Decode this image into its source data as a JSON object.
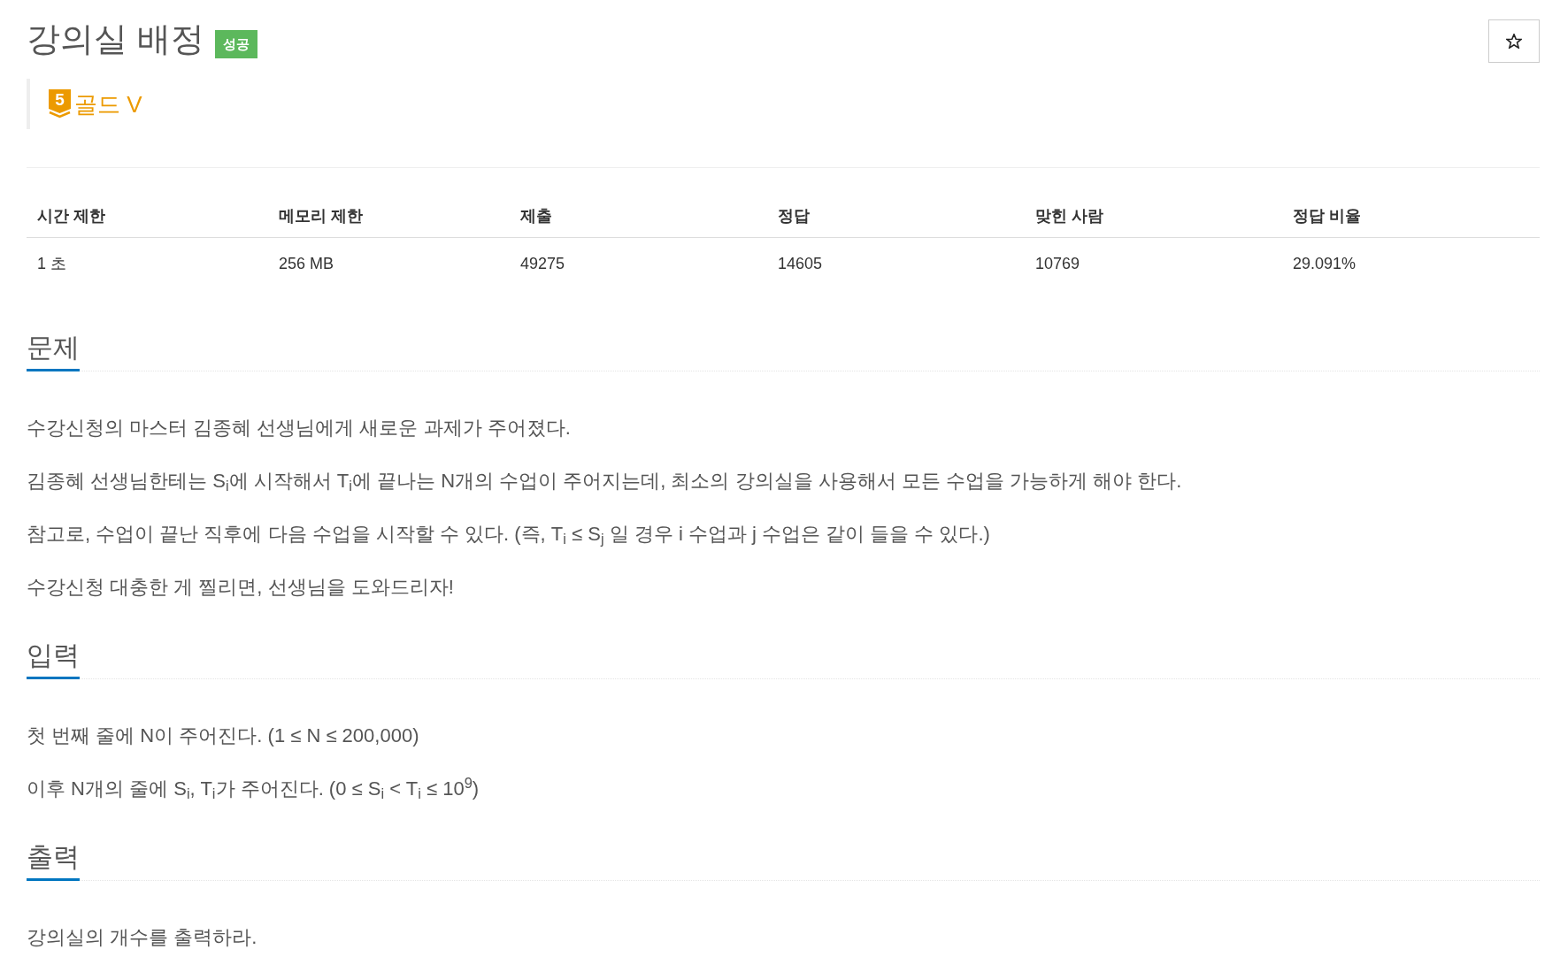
{
  "header": {
    "title": "강의실 배정",
    "result_badge": "성공",
    "bookmark": {
      "starred": false
    },
    "tier": {
      "number": "5",
      "label": "골드 V"
    }
  },
  "stats_table": {
    "columns": [
      "시간 제한",
      "메모리 제한",
      "제출",
      "정답",
      "맞힌 사람",
      "정답 비율"
    ],
    "rows": [
      [
        "1 초",
        "256 MB",
        "49275",
        "14605",
        "10769",
        "29.091%"
      ]
    ]
  },
  "sections": [
    {
      "heading": "문제",
      "paragraphs": [
        "수강신청의 마스터 김종혜 선생님에게 새로운 과제가 주어졌다.",
        "김종혜 선생님한테는 S$_{i}$에 시작해서 T$_{i}$에 끝나는 N개의 수업이 주어지는데, 최소의 강의실을 사용해서 모든 수업을 가능하게 해야 한다.",
        "참고로, 수업이 끝난 직후에 다음 수업을 시작할 수 있다. (즉, T$_{i}$ ≤ S$_{j}$ 일 경우 i 수업과 j 수업은 같이 들을 수 있다.)",
        "수강신청 대충한 게 찔리면, 선생님을 도와드리자!"
      ]
    },
    {
      "heading": "입력",
      "paragraphs": [
        "첫 번째 줄에 N이 주어진다. (1 ≤ N ≤ 200,000)",
        "이후 N개의 줄에 S$_{i}$, T$_{i}$가 주어진다. (0 ≤ S$_{i}$ < T$_{i}$ ≤ 10$^{9}$)"
      ]
    },
    {
      "heading": "출력",
      "paragraphs": [
        "강의실의 개수를 출력하라."
      ]
    }
  ]
}
